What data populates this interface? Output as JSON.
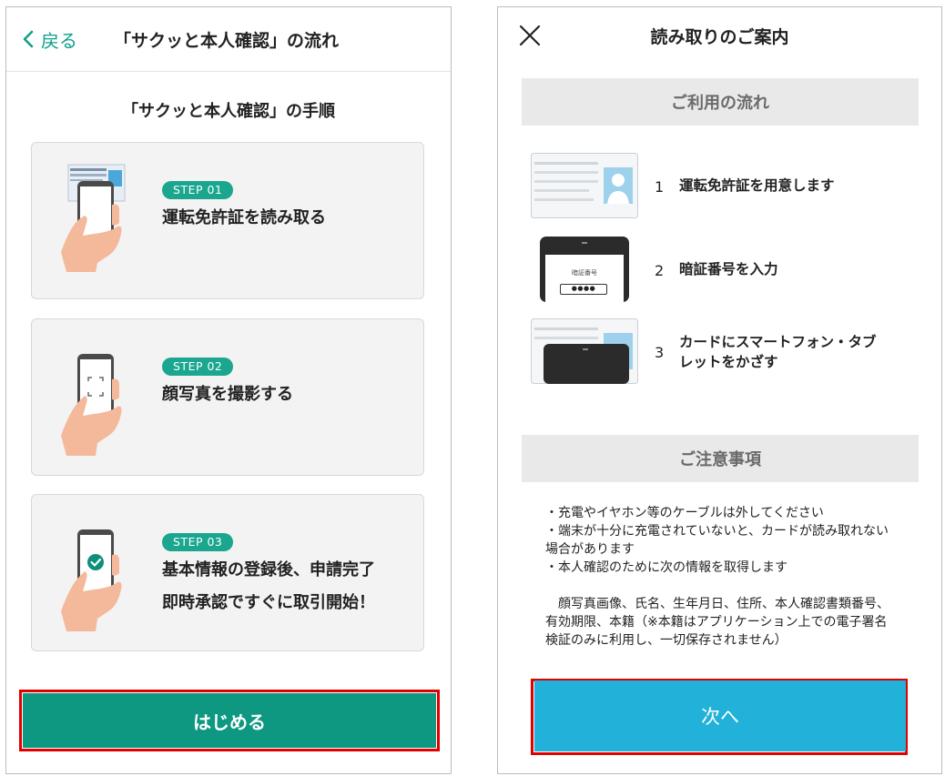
{
  "left_screen": {
    "back_label": "戻る",
    "header_title": "「サクッと本人確認」の流れ",
    "subtitle": "「サクッと本人確認」の手順",
    "steps": [
      {
        "badge": "STEP 01",
        "lines": [
          "運転免許証を読み取る"
        ]
      },
      {
        "badge": "STEP 02",
        "lines": [
          "顔写真を撮影する"
        ]
      },
      {
        "badge": "STEP 03",
        "lines": [
          "基本情報の登録後、申請完了",
          "即時承認ですぐに取引開始！"
        ]
      }
    ],
    "start_button": "はじめる",
    "accent_color": "#0e9882"
  },
  "right_screen": {
    "header_title": "読み取りのご案内",
    "section_flow": "ご利用の流れ",
    "flow_items": [
      {
        "num": "1",
        "lines": [
          "運転免許証を用意します"
        ]
      },
      {
        "num": "2",
        "lines": [
          "暗証番号を入力"
        ],
        "phone_label": "暗証番号",
        "pin_mask": "●●●●"
      },
      {
        "num": "3",
        "lines": [
          "カードにスマートフォン・タブ",
          "レットをかざす"
        ]
      }
    ],
    "section_notes": "ご注意事項",
    "notes": [
      "・充電やイヤホン等のケーブルは外してください",
      "・端末が十分に充電されていないと、カードが読み取れない場合があります",
      "・本人確認のために次の情報を取得します",
      "",
      "　顔写真画像、氏名、生年月日、住所、本人確認書類番号、有効期限、本籍（※本籍はアプリケーション上での電子署名検証のみに利用し、一切保存されません）"
    ],
    "next_button": "次へ",
    "next_color": "#22b1d8"
  }
}
